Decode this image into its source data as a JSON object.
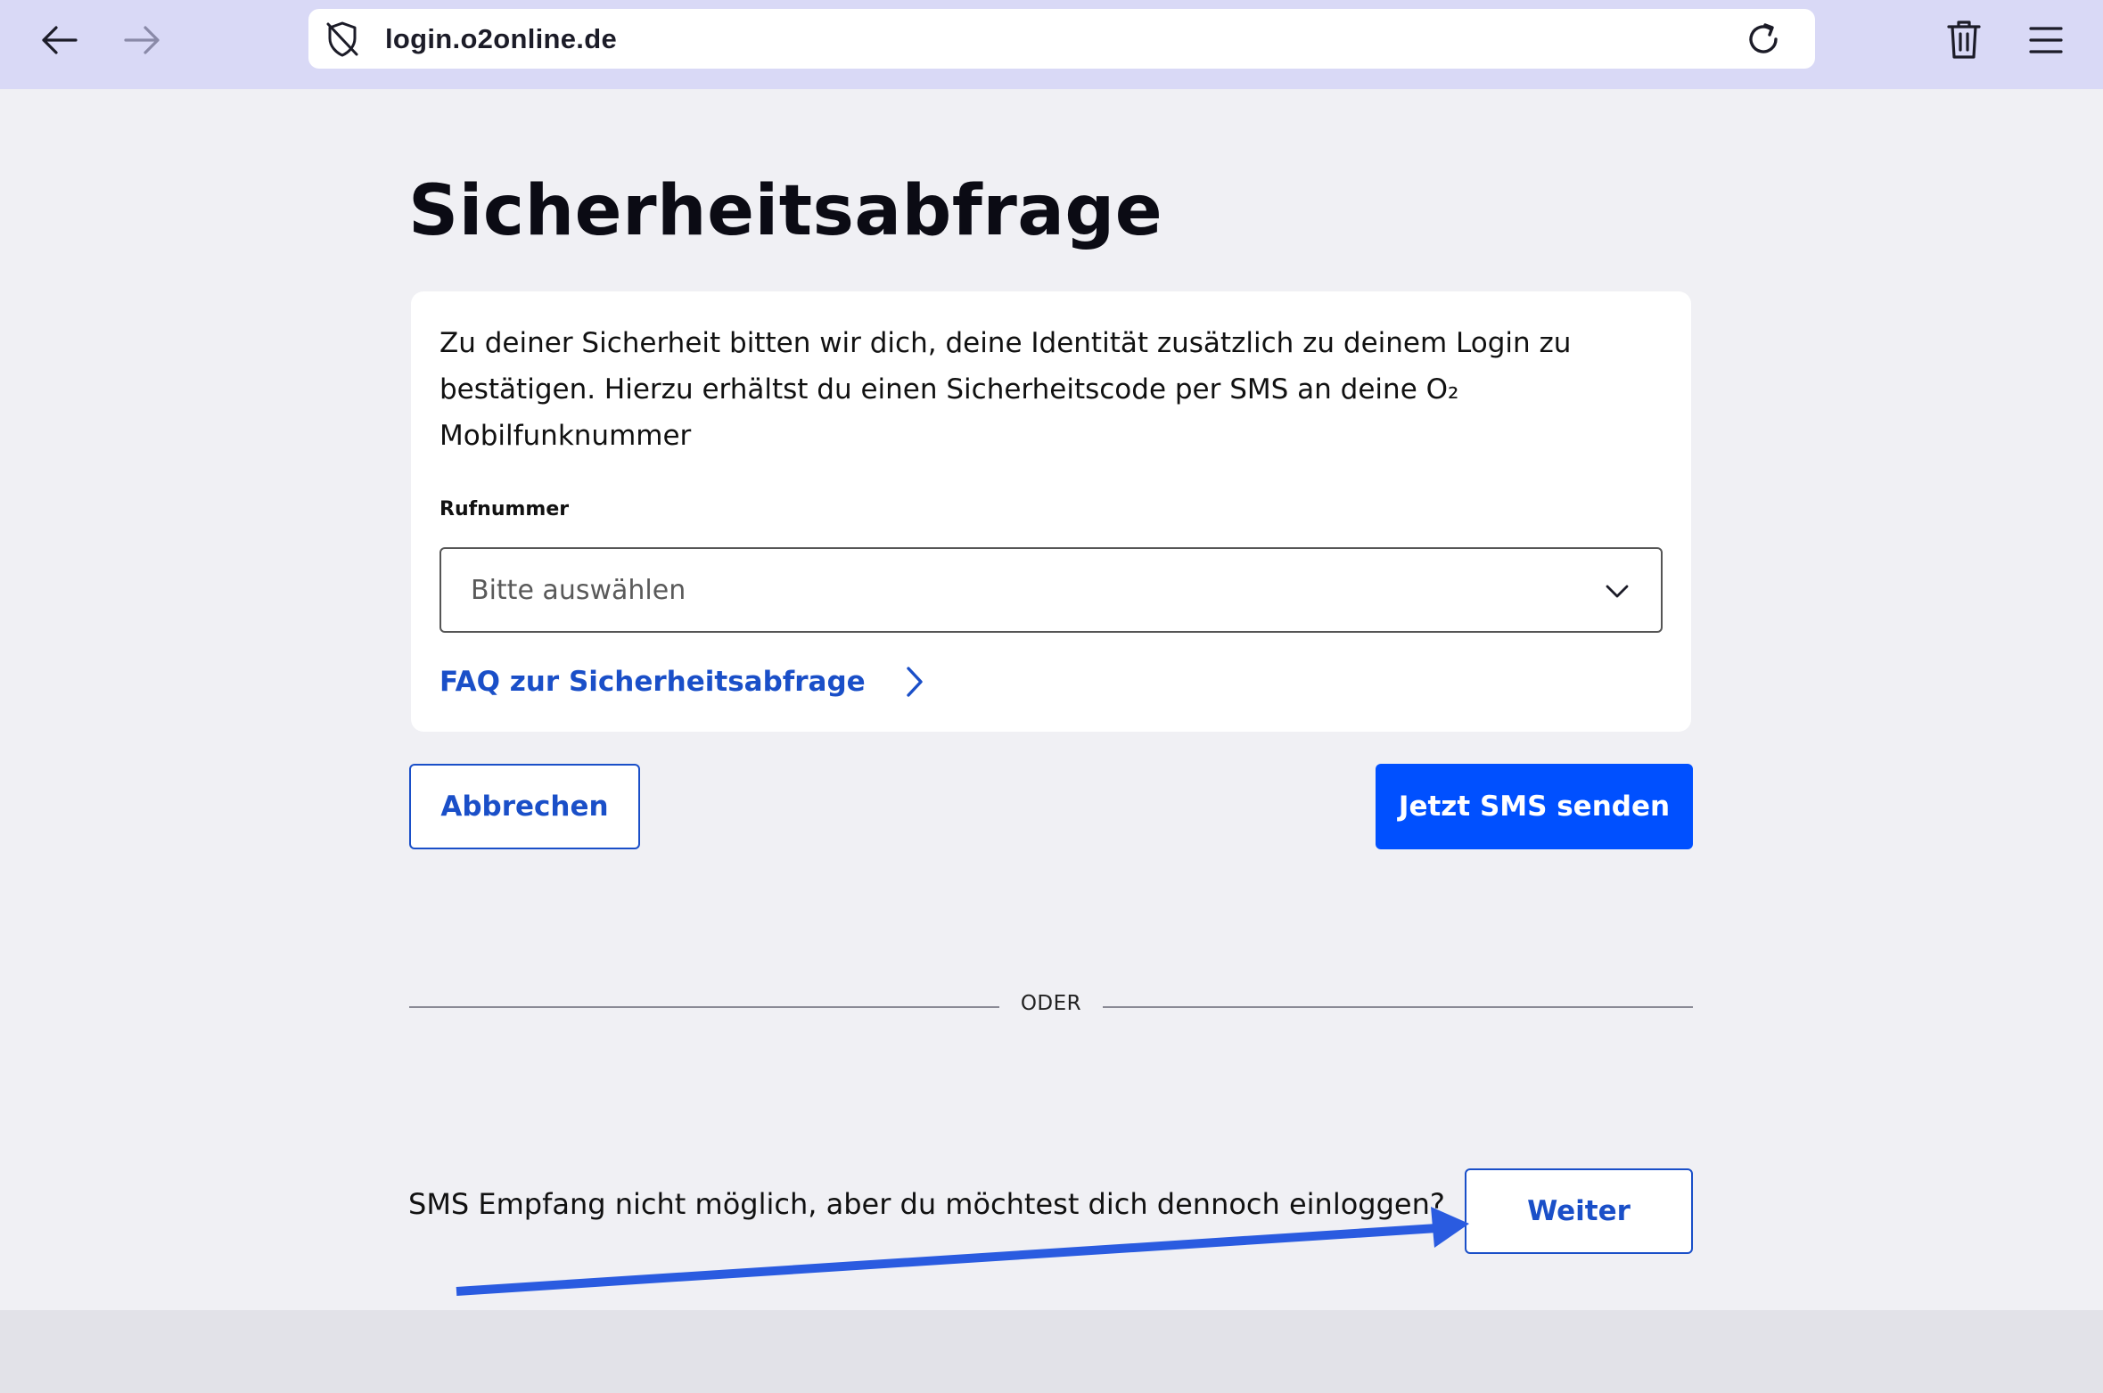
{
  "browser": {
    "url": "login.o2online.de",
    "icons": {
      "back": "arrow-left-icon",
      "forward": "arrow-right-icon",
      "privacy": "shield-off-icon",
      "reload": "reload-icon",
      "delete": "trash-icon",
      "menu": "hamburger-menu-icon"
    }
  },
  "page": {
    "title": "Sicherheitsabfrage",
    "description": "Zu deiner Sicherheit bitten wir dich, deine Identität zusätzlich zu deinem Login zu bestätigen. Hierzu erhältst du einen Sicherheitscode per SMS an deine O₂ Mobilfunknummer",
    "phone_field": {
      "label": "Rufnummer",
      "placeholder": "Bitte auswählen"
    },
    "faq_link": "FAQ zur Sicherheitsabfrage",
    "cancel_button": "Abbrechen",
    "send_sms_button": "Jetzt SMS senden",
    "divider_text": "ODER",
    "alt_question": "SMS Empfang nicht möglich, aber du möchtest dich dennoch einloggen?",
    "continue_button": "Weiter"
  },
  "colors": {
    "toolbar_bg": "#d9d9f6",
    "page_bg": "#f0f0f4",
    "link_blue": "#1a4fc8",
    "primary_blue": "#0050ff",
    "annotation_arrow": "#2a5be0"
  }
}
